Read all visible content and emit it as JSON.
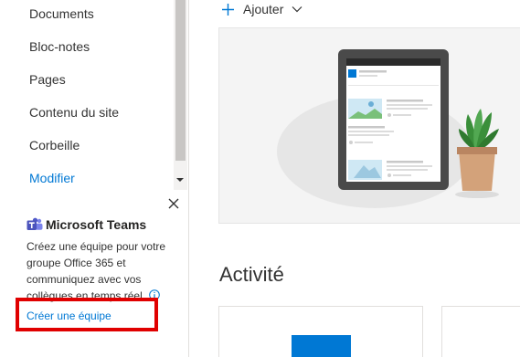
{
  "nav": {
    "items": [
      {
        "label": "Documents"
      },
      {
        "label": "Bloc-notes"
      },
      {
        "label": "Pages"
      },
      {
        "label": "Contenu du site"
      },
      {
        "label": "Corbeille"
      },
      {
        "label": "Modifier"
      }
    ]
  },
  "teams_promo": {
    "title": "Microsoft Teams",
    "description": "Créez une équipe pour votre groupe Office 365 et communiquez avec vos collègues en temps réel.",
    "link_label": "Créer une équipe",
    "close_icon": "close-icon",
    "info_icon": "info-icon"
  },
  "toolbar": {
    "add_label": "Ajouter"
  },
  "main": {
    "activity_title": "Activité"
  },
  "colors": {
    "accent": "#0078d4",
    "highlight": "#e00000",
    "plant_green": "#3a8f3a",
    "pot": "#d3a27a"
  }
}
